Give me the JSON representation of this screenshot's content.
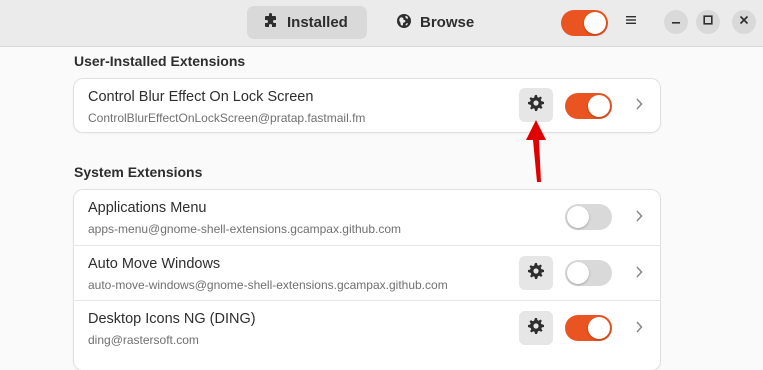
{
  "header": {
    "tabs": [
      {
        "label": "Installed",
        "icon": "puzzle-piece-icon",
        "active": true
      },
      {
        "label": "Browse",
        "icon": "globe-icon",
        "active": false
      }
    ],
    "extensions_enabled": true,
    "window_controls": [
      "menu-icon",
      "minimize-icon",
      "maximize-icon",
      "close-icon"
    ]
  },
  "user_section": {
    "title": "User-Installed Extensions",
    "items": [
      {
        "name": "Control Blur Effect On Lock Screen",
        "uuid": "ControlBlurEffectOnLockScreen@pratap.fastmail.fm",
        "has_settings": true,
        "enabled": true
      }
    ]
  },
  "system_section": {
    "title": "System Extensions",
    "items": [
      {
        "name": "Applications Menu",
        "uuid": "apps-menu@gnome-shell-extensions.gcampax.github.com",
        "has_settings": false,
        "enabled": false
      },
      {
        "name": "Auto Move Windows",
        "uuid": "auto-move-windows@gnome-shell-extensions.gcampax.github.com",
        "has_settings": true,
        "enabled": false
      },
      {
        "name": "Desktop Icons NG (DING)",
        "uuid": "ding@rastersoft.com",
        "has_settings": true,
        "enabled": true
      }
    ]
  },
  "colors": {
    "accent": "#e95420",
    "annotation_arrow": "#e00000"
  }
}
